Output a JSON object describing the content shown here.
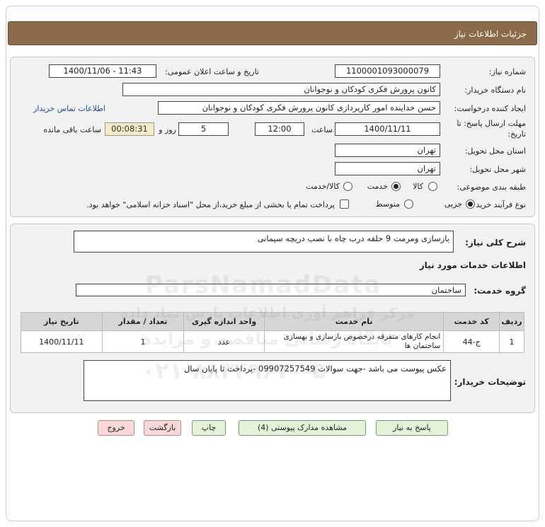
{
  "header": {
    "title": "جزئیات اطلاعات نیاز"
  },
  "form": {
    "need_number_label": "شماره نیاز:",
    "need_number": "1100001093000079",
    "announce_label": "تاریخ و ساعت اعلان عمومی:",
    "announce_value": "1400/11/06 - 11:43",
    "buyer_org_label": "نام دستگاه خریدار:",
    "buyer_org": "کانون پرورش فکری کودکان و نوجوانان",
    "requester_label": "ایجاد کننده درخواست:",
    "requester": "حسن خداینده امور کارپردازی  کانون پرورش فکری کودکان و نوجوانان",
    "contact_link": "اطلاعات تماس خریدار",
    "deadline_label_1": "مهلت ارسال پاسخ: تا",
    "deadline_label_2": "تاریخ:",
    "deadline_date": "1400/11/11",
    "time_label": "ساعت",
    "deadline_time": "12:00",
    "days_value": "5",
    "days_label": "روز و",
    "remaining_time": "00:08:31",
    "remaining_label": "ساعت باقی مانده",
    "province_label": "استان محل تحویل:",
    "province": "تهران",
    "city_label": "شهر محل تحویل:",
    "city": "تهران",
    "category_label": "طبقه بندی موضوعی:",
    "category_options": [
      "کالا",
      "خدمت",
      "کالا/خدمت"
    ],
    "category_selected": "خدمت",
    "process_label": "نوع فرآیند خرید :",
    "process_options": [
      "جزیی",
      "متوسط"
    ],
    "process_selected": "جزیی",
    "payment_note": "پرداخت تمام یا بخشی از مبلغ خرید،از محل \"اسناد خزانه اسلامی\" خواهد بود."
  },
  "details": {
    "summary_label": "شرح کلی نیاز:",
    "summary": "بازسازی ومرمت 9 حلقه درب چاه با نصب دریچه سیمانی",
    "services_heading": "اطلاعات خدمات مورد نیاز",
    "service_group_label": "گروه خدمت:",
    "service_group": "ساختمان",
    "table": {
      "headers": [
        "ردیف",
        "کد خدمت",
        "نام خدمت",
        "واحد اندازه گیری",
        "تعداد / مقدار",
        "تاریخ نیاز"
      ],
      "rows": [
        [
          "1",
          "ج-44",
          "انجام کارهای متفرقه درخصوص بازسازی و بهسازی ساختمان ها",
          "عدد",
          "1",
          "1400/11/11"
        ]
      ]
    },
    "buyer_notes_label": "توضیحات خریدار:",
    "buyer_notes": "عکس پیوست می باشد -جهت سوالات 09907257549 -پرداخت تا پایان سال"
  },
  "buttons": {
    "reply": "پاسخ به نیاز",
    "view_docs": "مشاهده مدارک پیوستی (4)",
    "print": "چاپ",
    "back": "بازگشت",
    "exit": "خروج"
  },
  "watermark": {
    "line1": "ParsNamadData",
    "line2": "مرکز فراهم آوری اطلاعات پارس نماد داده",
    "line3": "پایگاه رسانی مناقصه و مزایده",
    "line4": "۰۲۱-۸۸۳۴۹۶۷۰-۵"
  },
  "colors": {
    "title_bar": "#8b6b4a",
    "button_green": "#e4f2d8",
    "button_pink": "#f8d8d8",
    "link": "#1a4fa0"
  }
}
